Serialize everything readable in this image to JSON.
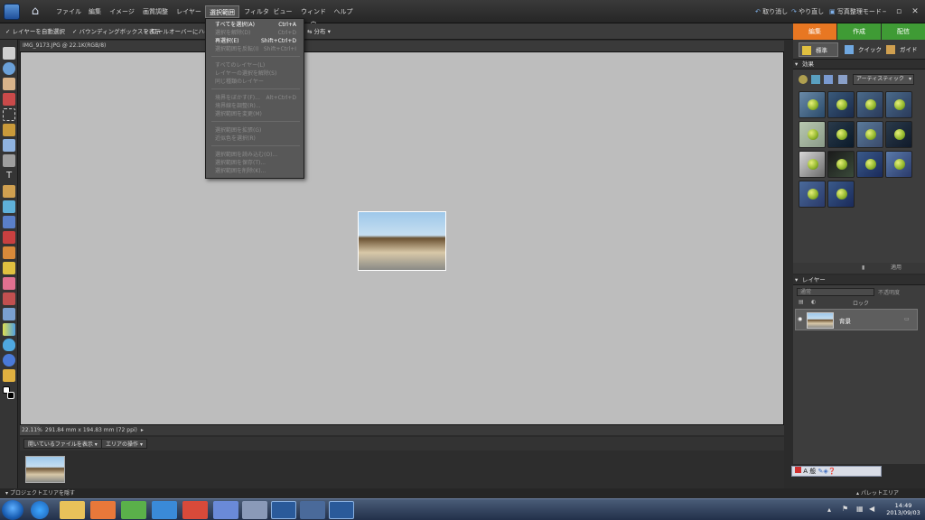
{
  "menubar": {
    "items": [
      "ファイル",
      "編集",
      "イメージ",
      "画質調整",
      "レイヤー",
      "選択範囲",
      "フィルタ",
      "ビュー",
      "ウィンドウ",
      "ヘルプ"
    ],
    "undo_label": "取り消し",
    "redo_label": "やり直し",
    "organizer_label": "写真整理モード"
  },
  "options": {
    "auto_select": "レイヤーを自動選択",
    "bounding_box": "バウンディングボックスを表示",
    "rollover": "ロールオーバーにハイライ",
    "distribute": "分布"
  },
  "document": {
    "tab_title": "IMG_9173.JPG @ 22.1K(RGB/8)",
    "zoom": "22.11%",
    "size_info": "291.84 mm x 194.83 mm (72 ppi)"
  },
  "select_menu": {
    "items": [
      {
        "label": "すべてを選択(A)",
        "shortcut": "Ctrl+A",
        "enabled": true
      },
      {
        "label": "選択を解除(D)",
        "shortcut": "Ctrl+D",
        "enabled": false
      },
      {
        "label": "再選択(E)",
        "shortcut": "Shift+Ctrl+D",
        "enabled": true
      },
      {
        "label": "選択範囲を反転(I)",
        "shortcut": "Shift+Ctrl+I",
        "enabled": false
      },
      {
        "separator": true
      },
      {
        "label": "すべてのレイヤー(L)",
        "shortcut": "",
        "enabled": false
      },
      {
        "label": "レイヤーの選択を解除(S)",
        "shortcut": "",
        "enabled": false
      },
      {
        "label": "同じ種類のレイヤー",
        "shortcut": "",
        "enabled": false
      },
      {
        "separator": true
      },
      {
        "label": "境界をぼかす(F)...",
        "shortcut": "Alt+Ctrl+D",
        "enabled": false
      },
      {
        "label": "境界線を調整(R)...",
        "shortcut": "",
        "enabled": false
      },
      {
        "label": "選択範囲を変更(M)",
        "shortcut": "",
        "enabled": false
      },
      {
        "separator": true
      },
      {
        "label": "選択範囲を拡張(G)",
        "shortcut": "",
        "enabled": false
      },
      {
        "label": "近似色を選択(R)",
        "shortcut": "",
        "enabled": false
      },
      {
        "separator": true
      },
      {
        "label": "選択範囲を読み込む(O)...",
        "shortcut": "",
        "enabled": false
      },
      {
        "label": "選択範囲を保存(T)...",
        "shortcut": "",
        "enabled": false
      },
      {
        "label": "選択範囲を削除(K)...",
        "shortcut": "",
        "enabled": false
      }
    ]
  },
  "right_panel": {
    "tabs": [
      {
        "label": "編集",
        "color": "#e87722"
      },
      {
        "label": "作成",
        "color": "#3f9b35"
      },
      {
        "label": "配信",
        "color": "#3f9b35"
      }
    ],
    "modes": [
      "標準",
      "クイック",
      "ガイド"
    ],
    "effects_title": "効果",
    "effects_filter": "アーティスティック",
    "apply_label": "適用",
    "layers_title": "レイヤー",
    "blend_mode": "通常",
    "opacity_label": "不透明度",
    "lock_label": "ロック",
    "layer_name": "背景"
  },
  "bin": {
    "show_files": "開いているファイルを表示",
    "area_ops": "エリアの操作"
  },
  "bottom": {
    "hide_project": "プロジェクトエリアを隠す",
    "palette_area": "パレットエリア"
  },
  "langbar": {
    "text": "A 般"
  },
  "taskbar": {
    "time": "14:49",
    "date": "2013/09/03"
  },
  "colors": {
    "edit_tab": "#e87722",
    "create_tab": "#3f9b35",
    "canvas": "#bdbdbd"
  }
}
